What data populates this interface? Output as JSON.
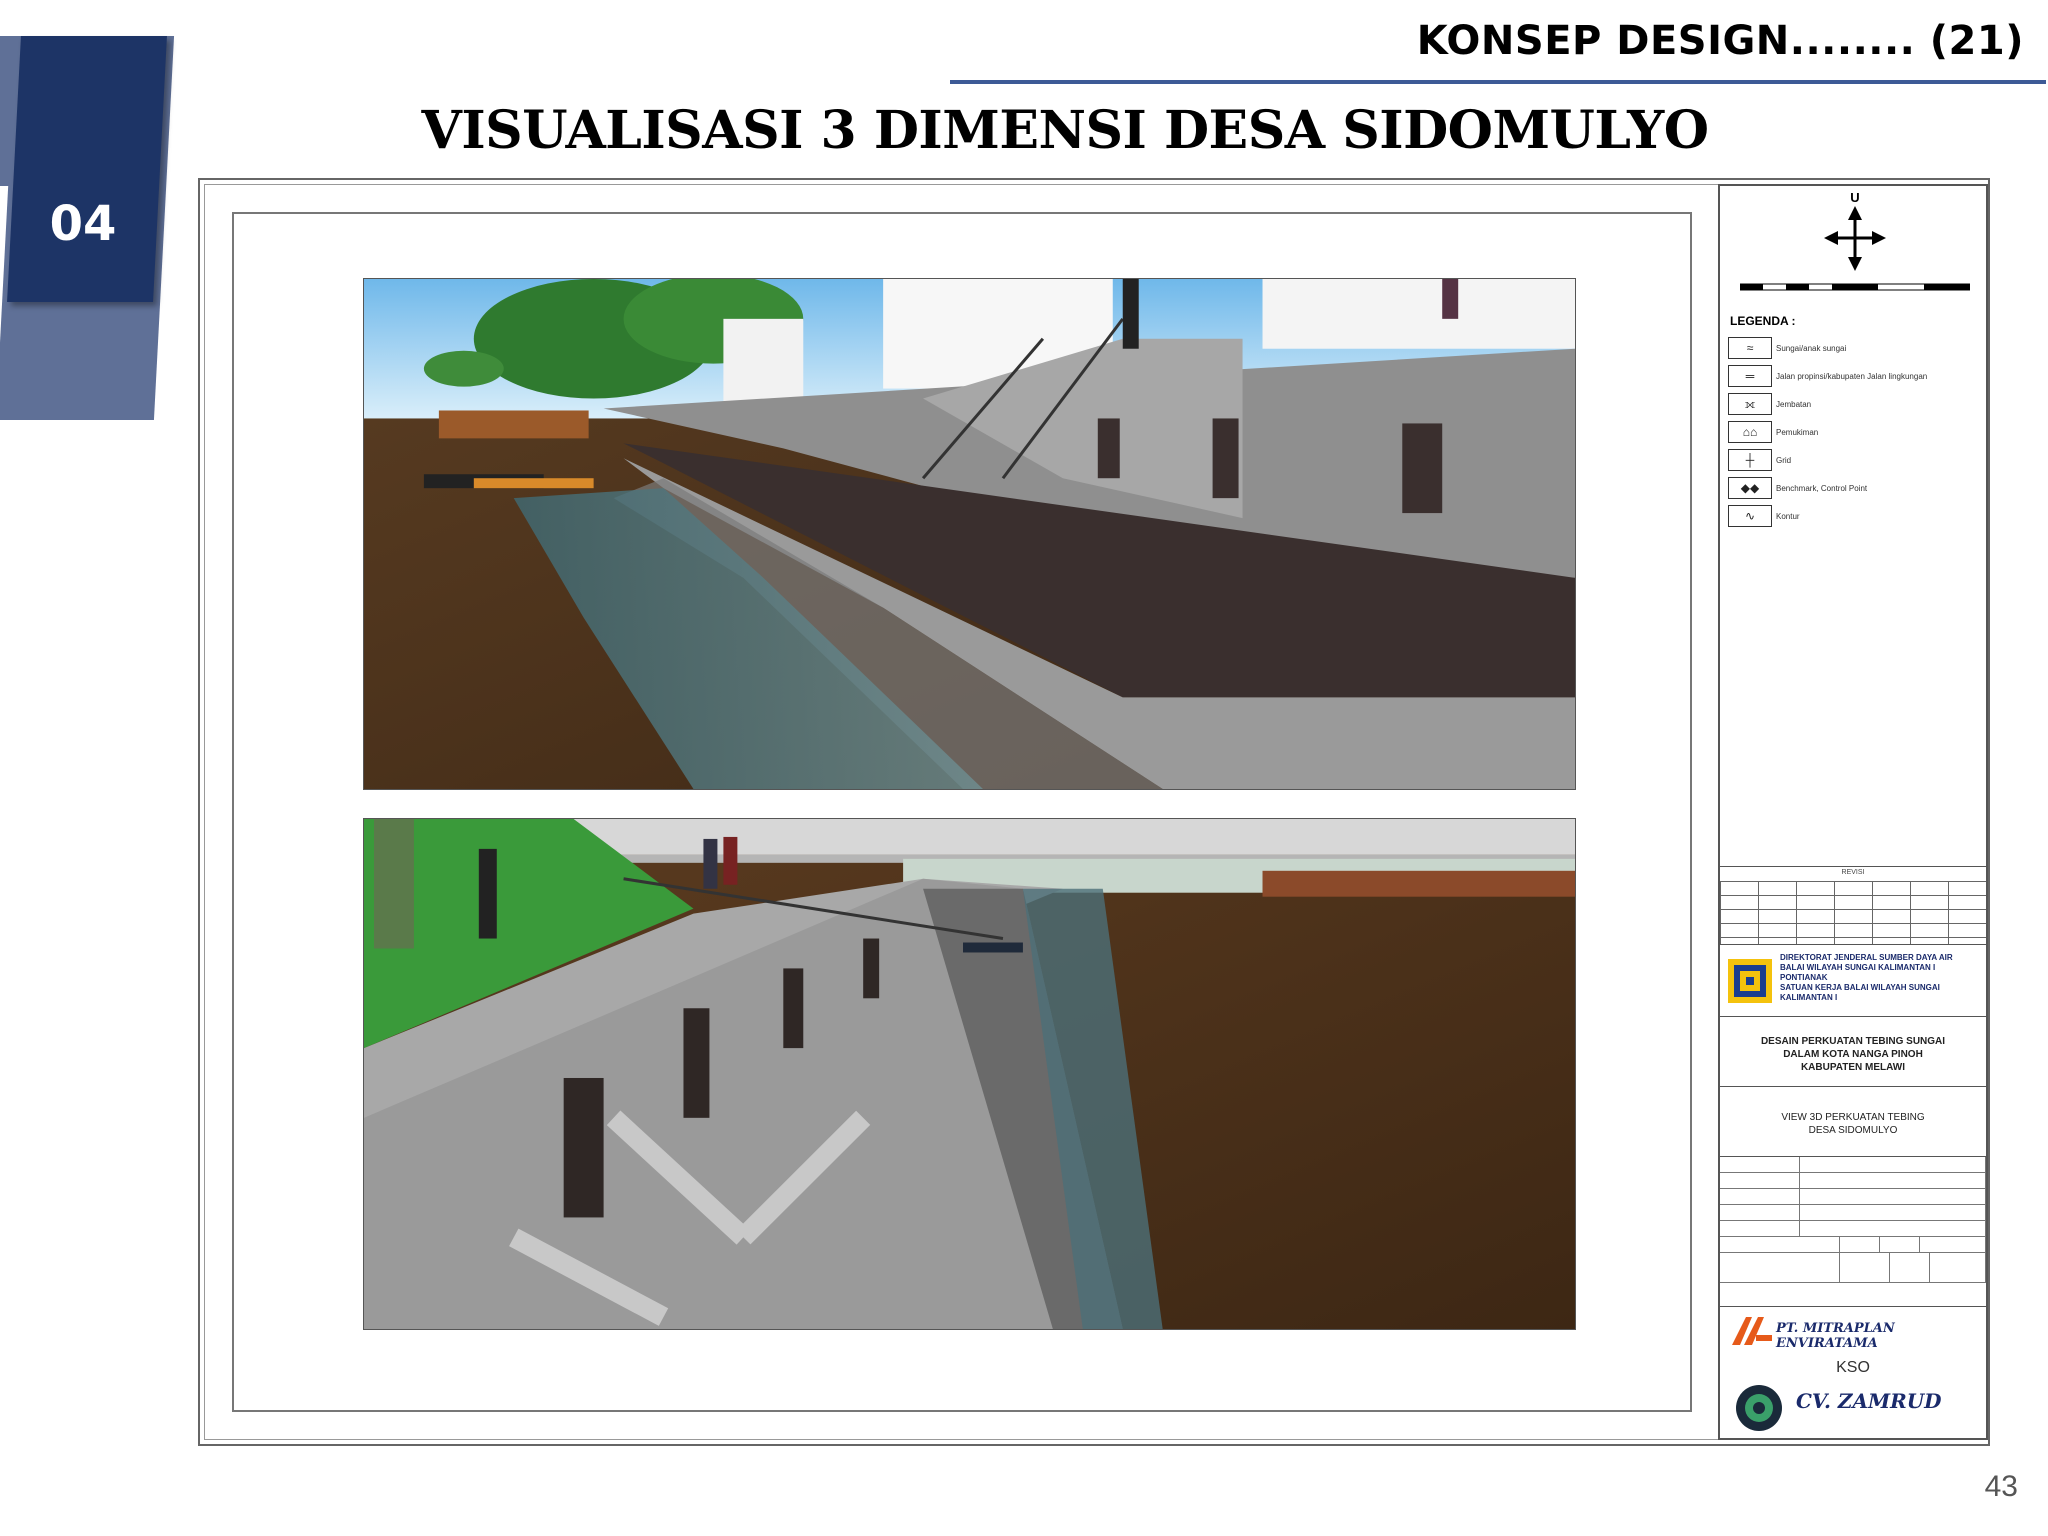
{
  "header": {
    "section_number": "04",
    "section_label": "KONSEP DESIGN........ (21)",
    "title": "VISUALISASI 3 DIMENSI DESA SIDOMULYO"
  },
  "title_block": {
    "north_label": "U",
    "legend_title": "LEGENDA :",
    "legend_items": [
      {
        "icon": "river-icon",
        "label": "Sungai/anak sungai"
      },
      {
        "icon": "road-icon",
        "label": "Jalan propinsi/kabupaten Jalan lingkungan"
      },
      {
        "icon": "bridge-icon",
        "label": "Jembatan"
      },
      {
        "icon": "settlement-icon",
        "label": "Pemukiman"
      },
      {
        "icon": "grid-icon",
        "label": "Grid"
      },
      {
        "icon": "benchmark-icon",
        "label": "Benchmark, Control Point"
      },
      {
        "icon": "contour-icon",
        "label": "Kontur"
      }
    ],
    "revisi_label": "REVISI",
    "agency_lines": [
      "DIREKTORAT JENDERAL SUMBER DAYA AIR",
      "BALAI WILAYAH SUNGAI KALIMANTAN I PONTIANAK",
      "SATUAN KERJA BALAI WILAYAH SUNGAI KALIMANTAN I"
    ],
    "project_lines": [
      "DESAIN PERKUATAN TEBING SUNGAI",
      "DALAM KOTA NANGA PINOH",
      "KABUPATEN MELAWI"
    ],
    "drawing_title_lines": [
      "VIEW 3D PERKUATAN TEBING",
      "DESA SIDOMULYO"
    ],
    "kso_label": "KSO",
    "company1": "PT. MITRAPLAN ENVIRATAMA",
    "company2": "CV. ZAMRUD"
  },
  "page_number": "43"
}
